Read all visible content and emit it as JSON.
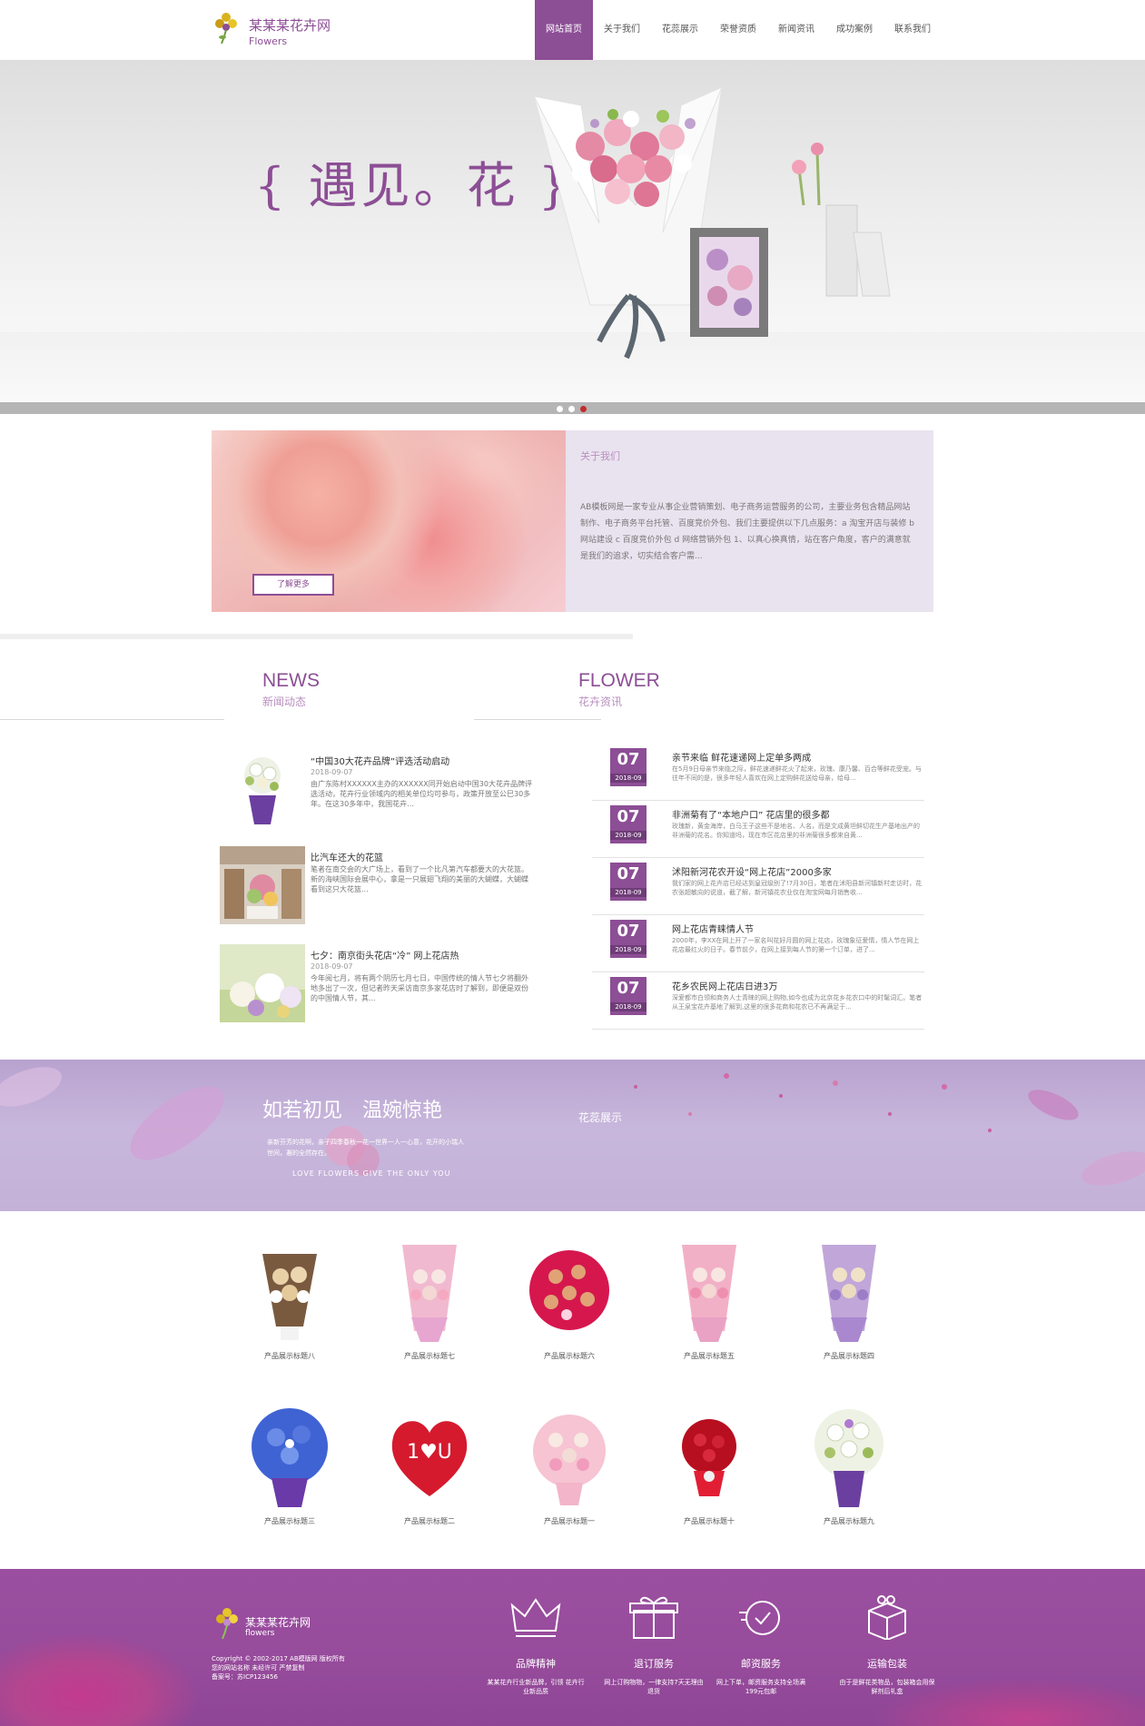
{
  "header": {
    "logo_title": "某某某花卉网",
    "logo_sub": "Flowers",
    "nav": [
      "网站首页",
      "关于我们",
      "花蕊展示",
      "荣誉资质",
      "新闻资讯",
      "成功案例",
      "联系我们"
    ],
    "active_nav": 0
  },
  "banner": {
    "title": "{ 遇见。花 }",
    "slides": 3,
    "active_slide": 2
  },
  "about": {
    "title": "关于我们",
    "body": "AB模板网是一家专业从事企业营销策划、电子商务运营服务的公司，主要业务包含精品网站制作、电子商务平台托管、百度竞价外包、我们主要提供以下几点服务：a 淘宝开店与装修 b 网站建设 c 百度竞价外包 d 网络营销外包 1、以真心换真情，站在客户角度，客户的满意就是我们的追求，切实结合客户需...",
    "button": "了解更多"
  },
  "news_section": {
    "en": "NEWS",
    "cn": "新闻动态"
  },
  "flower_section": {
    "en": "FLOWER",
    "cn": "花卉资讯"
  },
  "news": [
    {
      "title": "“中国30大花卉品牌”评选活动启动",
      "date": "2018-09-07",
      "desc": "由广东陈村XXXXXX主办的XXXXXX同开始启动中国30大花卉品牌评选活动，花卉行业领域内的相关单位均可参与，政策开放至公巳30多年。在这30多年中，我国花卉..."
    },
    {
      "title": "比汽车还大的花篮",
      "date": "2018-09-07",
      "desc": "笔者在南交会的大广场上，看到了一个比凡第汽车都要大的大花篮。新的海峡国际会展中心，拿是一只展翅飞翔的美丽的大蝴蝶，大蝴蝶看到这只大花篮..."
    },
    {
      "title": "七夕：南京街头花店“冷” 网上花店热",
      "date": "2018-09-07",
      "desc": "今年阅七月，将有两个阴历七月七日，中国传统的情人节七夕将翻外地多出了一次，但记者昨天采访南京多家花店时了解到，即便是双份的中国情人节，其..."
    }
  ],
  "flowers": [
    {
      "day": "07",
      "ym": "2018-09",
      "title": "亲节来临 鲜花速递网上定单多两成",
      "desc": "在5月9日母亲节来临之际，鲜花速递鲜花火了起来，玫瑰、康乃馨、百合等鲜花受宠。与往年不同的是，很多年轻人喜欢在网上定购鲜花送给母亲，给母..."
    },
    {
      "day": "07",
      "ym": "2018-09",
      "title": "非洲菊有了“本地户口” 花店里的很多都",
      "desc": "玫瑰新，黄金海岸，白马王子这些不是地名、人名，而是文成黄坦鲜切花生产基地出产的非洲菊的花名。你知道吗，现在市区花店里的非洲菊很多都来自黄..."
    },
    {
      "day": "07",
      "ym": "2018-09",
      "title": "沭阳新河花农开设“网上花店”2000多家",
      "desc": "我们家的网上花卉店已经达到皇冠级别了!7月30日，笔者在沭阳县新河镇新村走访时，花农张超敏向的说道，截了解，新河镇花农业仅在淘宝网每月销售收..."
    },
    {
      "day": "07",
      "ym": "2018-09",
      "title": "网上花店青睐情人节",
      "date": "",
      "desc": "2000年，李XX在网上开了一家名叫花好月圆的网上花店，玫瑰象征爱情，情人节在网上花店最红火的日子。春节前夕，在网上接到每人节的第一个订单，进了..."
    },
    {
      "day": "07",
      "ym": "2018-09",
      "title": "花乡农民网上花店日进3万",
      "desc": "深爱都市白领和商务人士青睐的网上购物,如今也成为北京花乡花农口中的时髦词汇。笔者从王泉宝花卉基地了解到,这里的很多花商和花农已不再满足于..."
    }
  ],
  "showcase": {
    "title": "如若初见　温婉惊艳",
    "sub": "亲新芬芳的花啊，亲子四季春秋一花一世界一人一心意，花开的小瑞人世间，邂的全然存在。",
    "love": "LOVE FLOWERS GIVE THE ONLY YOU",
    "tag": "花蕊展示"
  },
  "products_row1": [
    "产品展示标题八",
    "产品展示标题七",
    "产品展示标题六",
    "产品展示标题五",
    "产品展示标题四"
  ],
  "products_row2": [
    "产品展示标题三",
    "产品展示标题二",
    "产品展示标题一",
    "产品展示标题十",
    "产品展示标题九"
  ],
  "footer": {
    "logo_title": "某某某花卉网",
    "logo_sub": "flowers",
    "copyright": "Copyright © 2002-2017 AB模版网 版权所有",
    "site": "您的网站名称 未经许可 严禁复制",
    "icp": "备案号：苏ICP123456",
    "services": [
      {
        "title": "品牌精神",
        "desc": "某某花卉行业新品牌，引领 花卉行业新品质",
        "icon": "crown-icon"
      },
      {
        "title": "退订服务",
        "desc": "网上订购物物，一律支持7天无理由退货",
        "icon": "gift-icon"
      },
      {
        "title": "邮资服务",
        "desc": "网上下单，邮资服务支持全场满199元包邮",
        "icon": "clock-icon"
      },
      {
        "title": "运输包装",
        "desc": "由于是鲜花类物品，包装箱会用保鲜剂后礼盒",
        "icon": "box-icon"
      }
    ]
  },
  "colors": {
    "accent": "#8c4e95",
    "slide_active": "#c42b2b",
    "footer": "#964b9b"
  }
}
